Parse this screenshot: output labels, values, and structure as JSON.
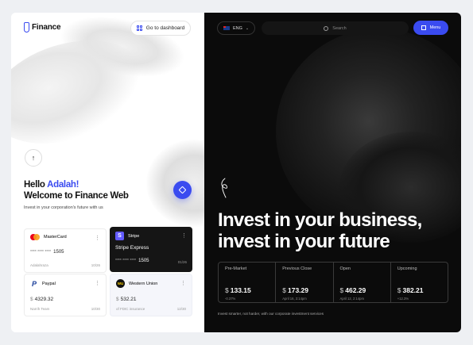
{
  "brand": {
    "name": "Finance"
  },
  "header_left": {
    "dashboard_label": "Go to dashboard"
  },
  "greeting": {
    "hello": "Hello",
    "user": "Adalah!",
    "welcome": "Welcome to Finance Web",
    "subtitle": "Invest in your corporation's future with us"
  },
  "cards": [
    {
      "name": "MasterCard",
      "mask": "**** **** ****",
      "last4": "1505",
      "holder": "Adalahraza",
      "expiry": "10/26",
      "logo_icon": "mastercard-icon"
    },
    {
      "name": "Stripe",
      "title": "Stripe Express",
      "mask": "**** **** ****",
      "last4": "1505",
      "expiry": "01/26",
      "logo_icon": "stripe-icon",
      "logo_letter": "S"
    },
    {
      "name": "Paypal",
      "currency": "$",
      "amount": "4329.32",
      "holder": "Narrih Team",
      "expiry": "10/30",
      "logo_icon": "paypal-icon",
      "logo_letter": "P"
    },
    {
      "name": "Western Union",
      "currency": "$",
      "amount": "532.21",
      "holder": "of FDIC insurance",
      "expiry": "12/30",
      "logo_icon": "western-union-icon",
      "logo_letter": "WU"
    }
  ],
  "topbar": {
    "lang": "ENG",
    "search_placeholder": "Search",
    "menu_label": "Menu",
    "chevron": "⌄"
  },
  "hero": {
    "line1": "Invest in your business,",
    "line2": "invest in your future"
  },
  "stats": [
    {
      "label": "Pre-Market",
      "currency": "$",
      "value": "133.15",
      "sub": "-0.37%"
    },
    {
      "label": "Previous Close",
      "currency": "$",
      "value": "173.29",
      "sub": "April 16, 3:14pm"
    },
    {
      "label": "Open",
      "currency": "$",
      "value": "462.29",
      "sub": "April 12, 2:14pm"
    },
    {
      "label": "Upcoming",
      "currency": "$",
      "value": "382.21",
      "sub": "+12.3%"
    }
  ],
  "tagline": "Invest smarter, not harder, with our corporate investment services",
  "colors": {
    "accent": "#3a4bf0",
    "dark": "#0b0b0b"
  }
}
